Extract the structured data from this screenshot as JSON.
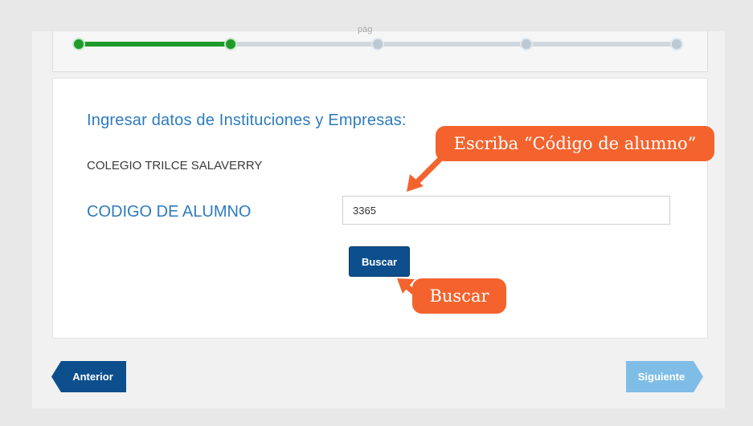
{
  "progress": {
    "step_label": "pág",
    "steps": [
      "done",
      "done",
      "pending",
      "pending",
      "pending"
    ],
    "completed_fraction": 0.25
  },
  "form": {
    "heading": "Ingresar datos de Instituciones y Empresas:",
    "institution": "COLEGIO TRILCE SALAVERRY",
    "code_label": "CODIGO DE ALUMNO",
    "code_value": "3365",
    "search_label": "Buscar"
  },
  "callouts": {
    "code_hint": "Escriba “Código de alumno”",
    "search_hint": "Buscar"
  },
  "navigation": {
    "previous_label": "Anterior",
    "next_label": "Siguiente"
  },
  "colors": {
    "accent_blue": "#0d4f8d",
    "heading_blue": "#2d7bbf",
    "progress_green": "#1f9b2b",
    "callout_orange": "#f4632e",
    "next_disabled": "#7fbde6"
  }
}
